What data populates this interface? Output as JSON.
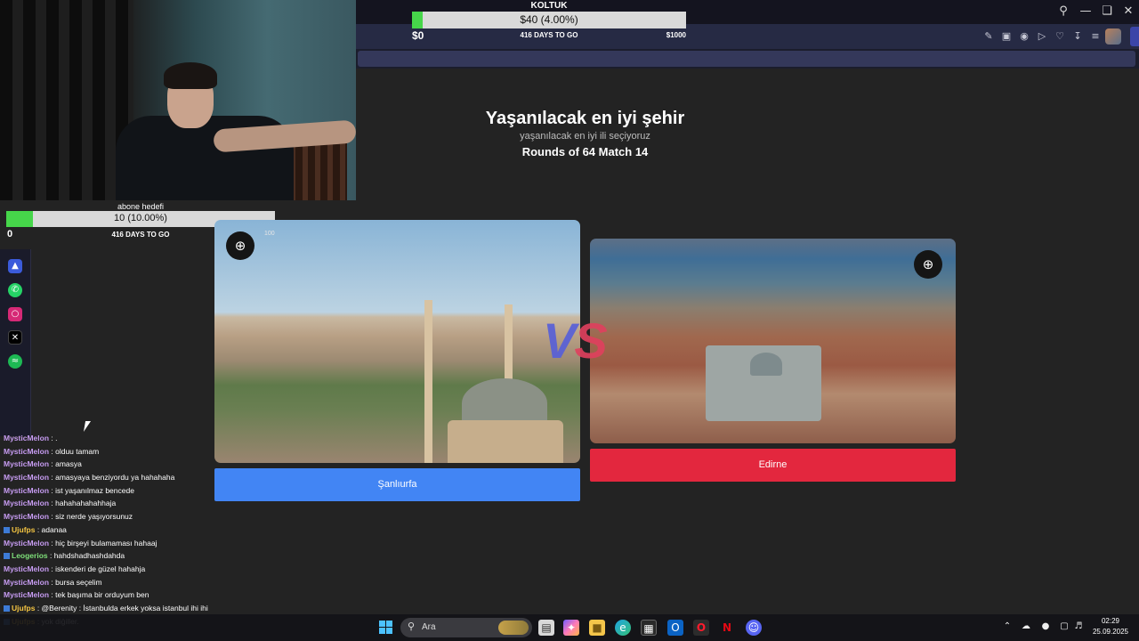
{
  "colors": {
    "accent_blue": "#4285f4",
    "accent_red": "#e3273e",
    "goal_fill": "#46d64a",
    "vs_left": "#5860d8",
    "vs_right": "#e0405e"
  },
  "top_goal": {
    "title": "KOLTUK",
    "bar_text": "$40 (4.00%)",
    "progress": 0.04,
    "min_label": "$0",
    "days_label": "416 DAYS TO GO",
    "max_label": "$1000"
  },
  "sub_goal": {
    "title": "abone hedefi",
    "bar_text": "10 (10.00%)",
    "progress": 0.1,
    "min_label": "0",
    "days_label": "416 DAYS TO GO"
  },
  "browser": {
    "window_controls": [
      "search-icon",
      "minimize-icon",
      "restore-icon",
      "close-icon"
    ],
    "toolbar_icons": [
      "edit-icon",
      "camera-icon",
      "shield-icon",
      "play-icon",
      "heart-icon",
      "download-icon",
      "menu-icon"
    ]
  },
  "sidebar": {
    "apps": [
      "aria-icon",
      "whatsapp-icon",
      "instagram-icon",
      "x-icon",
      "spotify-icon"
    ]
  },
  "main": {
    "title": "Yaşanılacak en iyi şehir",
    "subtitle": "yaşanılacak en iyi ili seçiyoruz",
    "round": "Rounds of 64 Match 14",
    "vote_count": "100",
    "vs_v": "V",
    "vs_s": "S",
    "left_choice": "Şanlıurfa",
    "right_choice": "Edirne"
  },
  "chat": [
    {
      "user": "MysticMelon",
      "color": "#c79cf2",
      "msg": " : ."
    },
    {
      "user": "MysticMelon",
      "color": "#c79cf2",
      "msg": " : olduu tamam"
    },
    {
      "user": "MysticMelon",
      "color": "#c79cf2",
      "msg": " : amasya"
    },
    {
      "user": "MysticMelon",
      "color": "#c79cf2",
      "msg": " : amasyaya benziyordu ya hahahaha"
    },
    {
      "user": "MysticMelon",
      "color": "#c79cf2",
      "msg": " : ist yaşanılmaz bencede"
    },
    {
      "user": "MysticMelon",
      "color": "#c79cf2",
      "msg": " : hahahahahahhaja"
    },
    {
      "user": "MysticMelon",
      "color": "#c79cf2",
      "msg": " : siz nerde yaşıyorsunuz"
    },
    {
      "user": "Ujufps",
      "color": "#f5c542",
      "msg": " : adanaa",
      "badge": true
    },
    {
      "user": "MysticMelon",
      "color": "#c79cf2",
      "msg": " : hiç birşeyi bulamaması hahaaj"
    },
    {
      "user": "Leogerios",
      "color": "#7fe07a",
      "msg": " : hahdshadhashdahda",
      "badge": true
    },
    {
      "user": "MysticMelon",
      "color": "#c79cf2",
      "msg": " : iskenderi de güzel hahahja"
    },
    {
      "user": "MysticMelon",
      "color": "#c79cf2",
      "msg": " : bursa seçelim"
    },
    {
      "user": "MysticMelon",
      "color": "#c79cf2",
      "msg": " : tek başıma bir orduyum ben"
    },
    {
      "user": "Ujufps",
      "color": "#f5c542",
      "msg": " : @Berenity : İstanbulda erkek yoksa istanbul ihi ihi",
      "badge": true
    },
    {
      "user": "Ujufps",
      "color": "#f5c542",
      "msg": " : yok diğiller.",
      "badge": true
    }
  ],
  "taskbar": {
    "search_placeholder": "Ara",
    "time": "02:29",
    "date": "25.09.2025",
    "apps": [
      "file-icon",
      "copilot-icon",
      "folder-icon",
      "edge-icon",
      "store-icon",
      "outlook-icon",
      "opera-icon",
      "netflix-icon",
      "discord-icon"
    ],
    "tray": [
      "chevron-up-icon",
      "network-off-icon",
      "mic-icon",
      "display-icon",
      "volume-icon"
    ]
  }
}
